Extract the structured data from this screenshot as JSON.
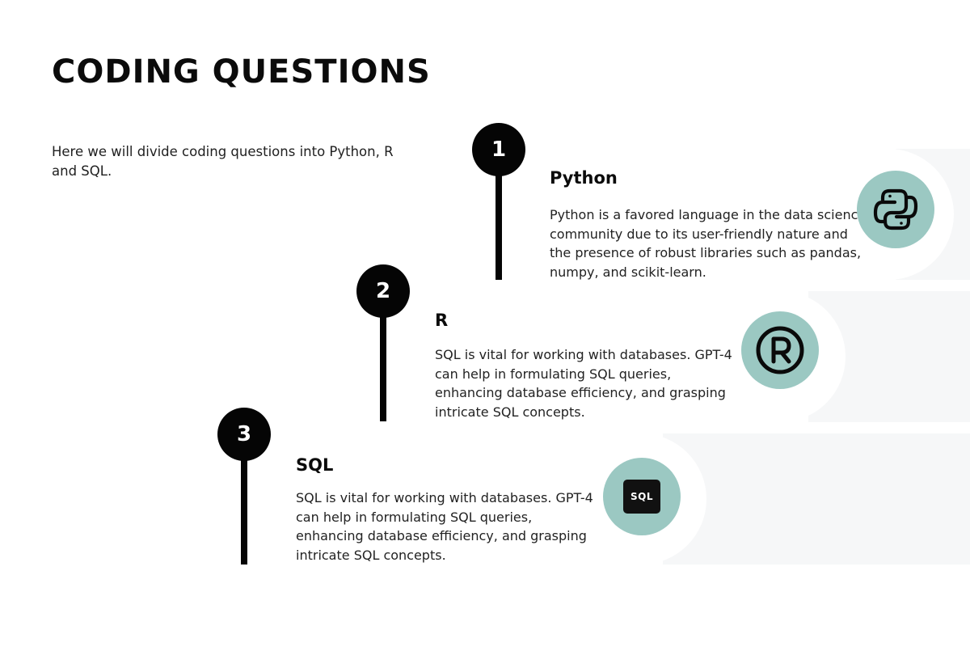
{
  "title": "CODING QUESTIONS",
  "intro": "Here we will divide coding questions into Python, R and SQL.",
  "items": [
    {
      "number": "1",
      "title": "Python",
      "description": "Python is a favored language in the data science community due to its user-friendly nature and the presence of robust libraries such as pandas, numpy, and scikit-learn.",
      "icon": "python-logo-icon"
    },
    {
      "number": "2",
      "title": "R",
      "description": "SQL is vital for working with databases. GPT-4 can help in formulating SQL queries, enhancing database efficiency, and grasping intricate SQL concepts.",
      "icon": "registered-r-icon"
    },
    {
      "number": "3",
      "title": "SQL",
      "description": "SQL is vital for working with databases. GPT-4 can help in formulating SQL queries, enhancing database efficiency, and grasping intricate SQL concepts.",
      "icon": "sql-icon",
      "icon_label": "SQL"
    }
  ],
  "colors": {
    "background": "#ffffff",
    "band": "#f6f7f8",
    "accent": "#9bc8c2",
    "pin": "#050505"
  }
}
